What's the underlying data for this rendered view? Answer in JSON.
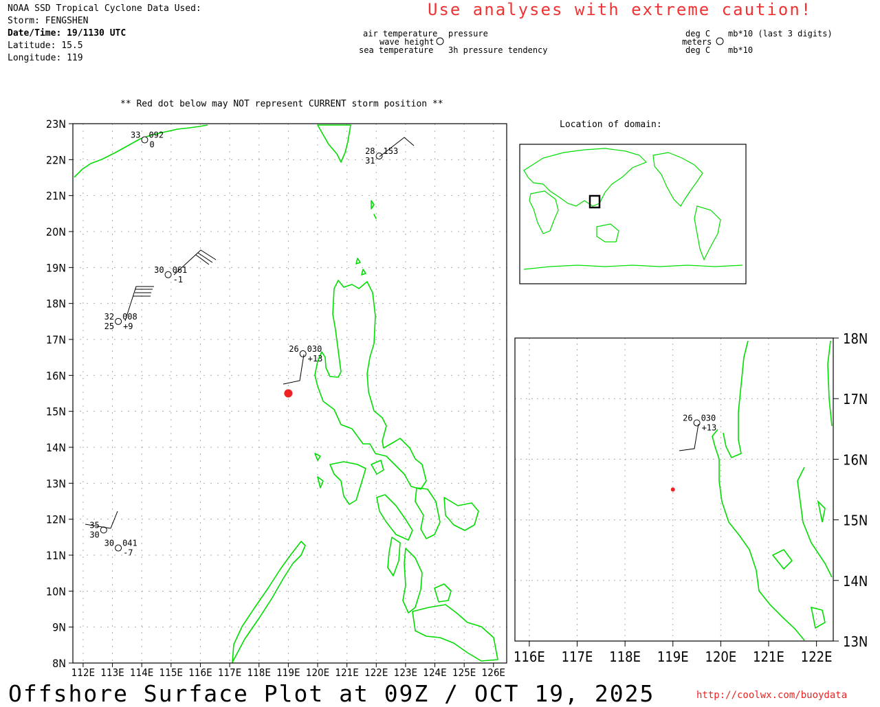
{
  "header": {
    "source": "NOAA SSD Tropical Cyclone Data Used:",
    "storm": "Storm: FENGSHEN",
    "datetime": "Date/Time: 19/1130 UTC",
    "latitude": "Latitude: 15.5",
    "longitude": "Longitude: 119"
  },
  "caution": "Use analyses with extreme caution!",
  "legend_left": {
    "air_temperature": "air temperature",
    "wave_height": "wave height",
    "sea_temperature": "sea temperature",
    "pressure": "pressure",
    "pressure_tendency": "3h pressure tendency"
  },
  "legend_right": {
    "deg_c_top": "deg C",
    "meters": "meters",
    "deg_c_bottom": "deg C",
    "mb_top": "mb*10 (last 3 digits)",
    "mb_bottom": "mb*10"
  },
  "warning": "** Red dot below may NOT represent CURRENT storm position **",
  "domain_title": "Location of domain:",
  "main_map": {
    "lat_labels": [
      "23N",
      "22N",
      "21N",
      "20N",
      "19N",
      "18N",
      "17N",
      "16N",
      "15N",
      "14N",
      "13N",
      "12N",
      "11N",
      "10N",
      "9N",
      "8N"
    ],
    "lon_labels": [
      "112E",
      "113E",
      "114E",
      "115E",
      "116E",
      "117E",
      "118E",
      "119E",
      "120E",
      "121E",
      "122E",
      "123E",
      "124E",
      "125E",
      "126E"
    ]
  },
  "zoom_map": {
    "lat_labels": [
      "18N",
      "17N",
      "16N",
      "15N",
      "14N",
      "13N"
    ],
    "lon_labels": [
      "116E",
      "117E",
      "118E",
      "119E",
      "120E",
      "121E",
      "122E"
    ]
  },
  "storm_position": {
    "lat": 15.5,
    "lon": 119.0
  },
  "stations": [
    {
      "lat": 22.55,
      "lon": 114.1,
      "air": "33",
      "press": "092",
      "sea": "",
      "tend": "0"
    },
    {
      "lat": 22.1,
      "lon": 122.1,
      "air": "28",
      "press": "153",
      "sea": "31",
      "tend": ""
    },
    {
      "lat": 18.8,
      "lon": 114.9,
      "air": "30",
      "press": "061",
      "sea": "",
      "tend": "-1"
    },
    {
      "lat": 17.5,
      "lon": 113.2,
      "air": "32",
      "press": "008",
      "sea": "25",
      "tend": "+9"
    },
    {
      "lat": 16.6,
      "lon": 119.5,
      "air": "26",
      "press": "030",
      "sea": "",
      "tend": "+13"
    },
    {
      "lat": 11.7,
      "lon": 112.7,
      "air": "35",
      "press": "",
      "sea": "30",
      "tend": ""
    },
    {
      "lat": 11.2,
      "lon": 113.2,
      "air": "30",
      "press": "041",
      "sea": "",
      "tend": "-7"
    }
  ],
  "footer": "Offshore Surface Plot at 09Z / OCT 19, 2025",
  "url": "http://coolwx.com/buoydata",
  "colors": {
    "coast": "#00dd00",
    "storm": "#ee2222",
    "grid": "#aaaaaa",
    "text_red": "#ee2222"
  }
}
